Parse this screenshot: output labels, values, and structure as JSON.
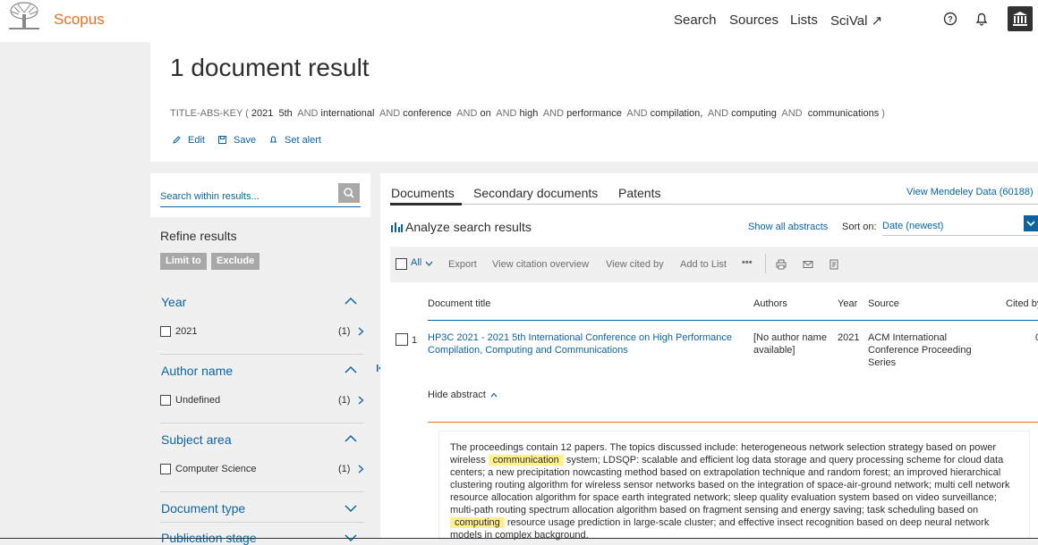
{
  "header": {
    "brand": "Scopus",
    "nav": [
      "Search",
      "Sources",
      "Lists",
      "SciVal ↗"
    ]
  },
  "page": {
    "title": "1 document result",
    "query": [
      {
        "t": "TITLE-ABS-KEY ( ",
        "op": true
      },
      {
        "t": "2021  5th  ",
        "op": false
      },
      {
        "t": "AND ",
        "op": true
      },
      {
        "t": "international  ",
        "op": false
      },
      {
        "t": "AND ",
        "op": true
      },
      {
        "t": "conference  ",
        "op": false
      },
      {
        "t": "AND ",
        "op": true
      },
      {
        "t": "on  ",
        "op": false
      },
      {
        "t": "AND ",
        "op": true
      },
      {
        "t": "high  ",
        "op": false
      },
      {
        "t": "AND ",
        "op": true
      },
      {
        "t": "performance  ",
        "op": false
      },
      {
        "t": "AND ",
        "op": true
      },
      {
        "t": "compilation,  ",
        "op": false
      },
      {
        "t": "AND ",
        "op": true
      },
      {
        "t": "computing  ",
        "op": false
      },
      {
        "t": "AND  ",
        "op": true
      },
      {
        "t": "communications ",
        "op": false
      },
      {
        "t": ")",
        "op": true
      }
    ],
    "actions": {
      "edit": "Edit",
      "save": "Save",
      "alert": "Set alert"
    }
  },
  "sidebar": {
    "search_placeholder": "Search within results...",
    "refine": "Refine results",
    "limit_to": "Limit to",
    "exclude": "Exclude",
    "facets": [
      {
        "title": "Year",
        "item": "2021",
        "count": "(1)"
      },
      {
        "title": "Author name",
        "item": "Undefined",
        "count": "(1)"
      },
      {
        "title": "Subject area",
        "item": "Computer Science",
        "count": "(1)"
      },
      {
        "title": "Document type"
      },
      {
        "title": "Publication stage"
      }
    ]
  },
  "results": {
    "tabs": [
      "Documents",
      "Secondary documents",
      "Patents"
    ],
    "mendeley": "View Mendeley Data (60188)",
    "analyze": "Analyze search results",
    "show_abstracts": "Show all abstracts",
    "sort_label": "Sort on:",
    "sort_value": "Date (newest)",
    "toolbar": {
      "all": "All",
      "export": "Export",
      "citation": "View citation overview",
      "cited": "View cited by",
      "addlist": "Add to List",
      "more": "•••"
    },
    "columns": {
      "title": "Document title",
      "authors": "Authors",
      "year": "Year",
      "source": "Source",
      "cited": "Cited by"
    },
    "rows": [
      {
        "num": "1",
        "title": "HP3C 2021 - 2021 5th International Conference on High Performance Compilation, Computing and Communications",
        "authors": "[No author name available]",
        "year": "2021",
        "source": "ACM International Conference Proceeding Series",
        "cited": "0"
      }
    ],
    "hide_abstract": "Hide abstract",
    "abstract": {
      "pre": "The proceedings contain 12 papers. The topics discussed include: heterogeneous network selection strategy based on power wireless ",
      "hl1": "communication",
      "mid": " system; LDSQP: scalable and efficient log data storage and query processing scheme for cloud data centers; a new precipitation nowcasting method based on extrapolation technique and random forest; an improved hierarchical clustering routing algorithm for wireless sensor networks based on the integration of space-air-ground network; multi cell network resource allocation algorithm for space earth integrated network; sleep quality evaluation system based on video surveillance; multi-path routing spectrum allocation algorithm based on fragment sensing and energy saving; task scheduling based on ",
      "hl2": "computing",
      "post": " resource usage prediction in large-scale cluster; and effective insect recognition based on deep neural network models in complex background."
    }
  },
  "colors": {
    "brand": "#e9711c",
    "link": "#0b64a0",
    "highlight": "#fff08c"
  }
}
